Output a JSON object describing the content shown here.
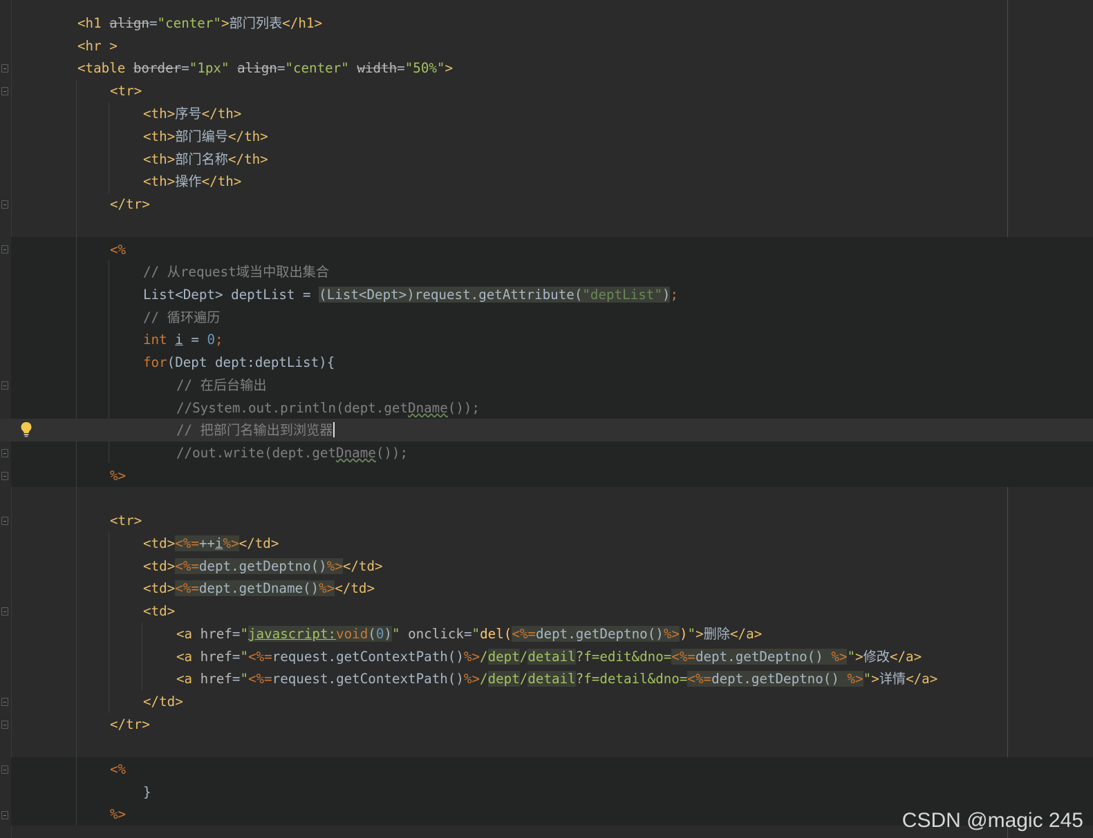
{
  "editor": {
    "lines": {
      "l1": {
        "open": "<h1 ",
        "attr": "align",
        "eq": "=",
        "val": "\"center\"",
        "gt": ">",
        "text": "部门列表",
        "close": "</h1>"
      },
      "l2": {
        "tag": "<hr >"
      },
      "l3": {
        "open": "<table ",
        "a1": "border",
        "v1": "\"1px\"",
        "a2": "align",
        "v2": "\"center\"",
        "a3": "width",
        "v3": "\"50%\"",
        "gt": ">",
        "eq": "="
      },
      "l4": {
        "tag": "<tr>"
      },
      "l5": {
        "open": "<th>",
        "text": "序号",
        "close": "</th>"
      },
      "l6": {
        "open": "<th>",
        "text": "部门编号",
        "close": "</th>"
      },
      "l7": {
        "open": "<th>",
        "text": "部门名称",
        "close": "</th>"
      },
      "l8": {
        "open": "<th>",
        "text": "操作",
        "close": "</th>"
      },
      "l9": {
        "tag": "</tr>"
      },
      "l11": {
        "delim": "<%"
      },
      "l12": {
        "comment": "// 从request域当中取出集合"
      },
      "l13": {
        "decl": "List<Dept> deptList = ",
        "cast": "(List<Dept>)request.getAttribute(",
        "str": "\"deptList\"",
        "paren": ")",
        "semi": ";"
      },
      "l14": {
        "comment": "// 循环遍历"
      },
      "l15": {
        "kw": "int",
        "sp": " ",
        "var": "i",
        "eq": " = ",
        "num": "0",
        "semi": ";"
      },
      "l16": {
        "kw": "for",
        "rest": "(Dept dept:deptList){"
      },
      "l17": {
        "comment": "// 在后台输出"
      },
      "l18": {
        "pre": "//System.out.println(dept.get",
        "warn": "Dname",
        "post": "());"
      },
      "l19": {
        "comment": "// 把部门名输出到浏览器"
      },
      "l20": {
        "pre": "//out.write(dept.get",
        "warn": "Dname",
        "post": "());"
      },
      "l21": {
        "delim": "%>"
      },
      "l23": {
        "tag": "<tr>"
      },
      "l24": {
        "open": "<td>",
        "d1": "<%=",
        "expr": "++",
        "var": "i",
        "d2": "%>",
        "close": "</td>"
      },
      "l25": {
        "open": "<td>",
        "d1": "<%=",
        "expr": "dept.getDeptno()",
        "d2": "%>",
        "close": "</td>"
      },
      "l26": {
        "open": "<td>",
        "d1": "<%=",
        "expr": "dept.getDname()",
        "d2": "%>",
        "close": "</td>"
      },
      "l27": {
        "tag": "<td>"
      },
      "l28": {
        "open": "<a ",
        "href": "href",
        "eq": "=",
        "q": "\"",
        "js": "javascript:",
        "void": "void",
        "lp": "(",
        "zero": "0",
        "rp": ")",
        "q2": "\"",
        "sp": " ",
        "onclick": "onclick",
        "eq2": "=",
        "q3": "\"",
        "fn": "del(",
        "d1": "<%=",
        "expr": "dept.getDeptno()",
        "d2": "%>",
        "rp2": ")",
        "q4": "\"",
        "gt": ">",
        "text": "删除",
        "close": "</a>"
      },
      "l29": {
        "open": "<a ",
        "href": "href",
        "eq": "=",
        "q": "\"",
        "d1": "<%=",
        "ctx": "request.getContextPath()",
        "d2": "%>",
        "s1": "/",
        "p1": "dept",
        "s2": "/",
        "p2": "detail",
        "query": "?f=edit&dno=",
        "d3": "<%=",
        "expr": "dept.getDeptno() ",
        "d4": "%>",
        "q2": "\"",
        "gt": ">",
        "text": "修改",
        "close": "</a>"
      },
      "l30": {
        "open": "<a ",
        "href": "href",
        "eq": "=",
        "q": "\"",
        "d1": "<%=",
        "ctx": "request.getContextPath()",
        "d2": "%>",
        "s1": "/",
        "p1": "dept",
        "s2": "/",
        "p2": "detail",
        "query": "?f=detail&dno=",
        "d3": "<%=",
        "expr": "dept.getDeptno() ",
        "d4": "%>",
        "q2": "\"",
        "gt": ">",
        "text": "详情",
        "close": "</a>"
      },
      "l31": {
        "tag": "</td>"
      },
      "l32": {
        "tag": "</tr>"
      },
      "l34": {
        "delim": "<%"
      },
      "l35": {
        "brace": "}"
      },
      "l36": {
        "delim": "%>"
      }
    }
  },
  "watermark": "CSDN @magic 245",
  "icons": {
    "bulb": "lightbulb-icon",
    "fold": "fold-marker-icon"
  },
  "colors": {
    "background": "#2b2b2b",
    "tag": "#e8bf6a",
    "string": "#a5c261",
    "keyword": "#cc7832",
    "comment": "#808080",
    "number": "#6897bb",
    "text": "#a9b7c6"
  }
}
